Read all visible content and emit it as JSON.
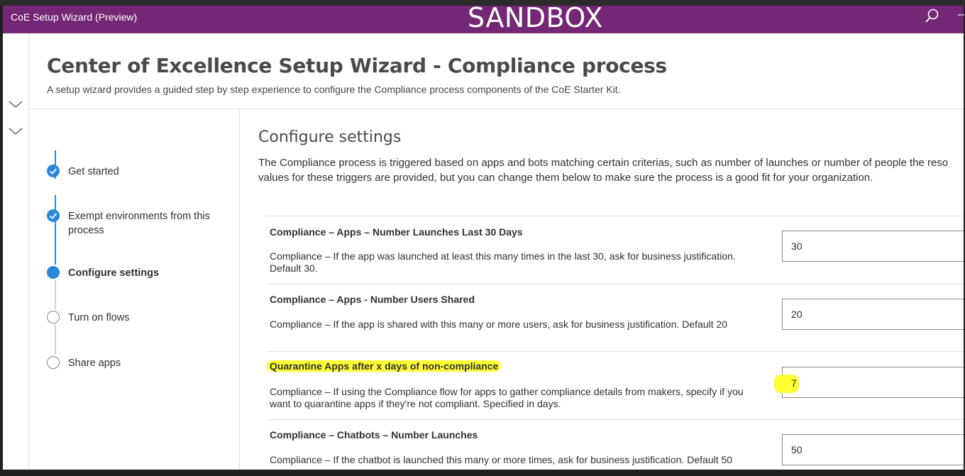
{
  "appbar": {
    "title": "CoE Setup Wizard (Preview)",
    "environment": "SANDBOX",
    "icons": {
      "search": "search-icon",
      "more": "more-icon"
    },
    "color": "#742774"
  },
  "rail": {
    "icons": [
      "chevron-down-icon",
      "chevron-down-icon"
    ]
  },
  "header": {
    "title": "Center of Excellence Setup Wizard - Compliance process",
    "subtitle": "A setup wizard provides a guided step by step experience to configure the Compliance process components of the CoE Starter Kit."
  },
  "steps": [
    {
      "label": "Get started",
      "state": "done"
    },
    {
      "label": "Exempt environments from this process",
      "state": "done"
    },
    {
      "label": "Configure settings",
      "state": "current"
    },
    {
      "label": "Turn on flows",
      "state": "todo"
    },
    {
      "label": "Share apps",
      "state": "todo"
    }
  ],
  "section": {
    "title": "Configure settings",
    "description_line1": "The Compliance process is triggered based on apps and bots matching certain criterias, such as number of launches or number of people the reso",
    "description_line2": "values for these triggers are provided, but you can change them below to make sure the process is a good fit for your organization."
  },
  "settings": [
    {
      "name": "Compliance – Apps – Number Launches Last 30 Days",
      "help": "Compliance – If the app was launched at least this many times in the last 30, ask for business justification. Default 30.",
      "value": "30"
    },
    {
      "name": "Compliance – Apps - Number Users Shared",
      "help": "Compliance – If the app is shared with this many or more users, ask for business justification. Default 20",
      "value": "20"
    },
    {
      "name": "Quarantine Apps after x days of non-compliance",
      "help": "Compliance – If using the Compliance flow for apps to gather compliance details from makers, specify if you want to quarantine apps if they're not compliant. Specified in days.",
      "value": "7",
      "highlighted": true
    },
    {
      "name": "Compliance – Chatbots – Number Launches",
      "help": "Compliance – If the chatbot is launched this many or more times, ask for business justification. Default 50",
      "value": "50"
    }
  ],
  "colors": {
    "accent": "#2b88d8",
    "highlight": "#ffff33"
  }
}
